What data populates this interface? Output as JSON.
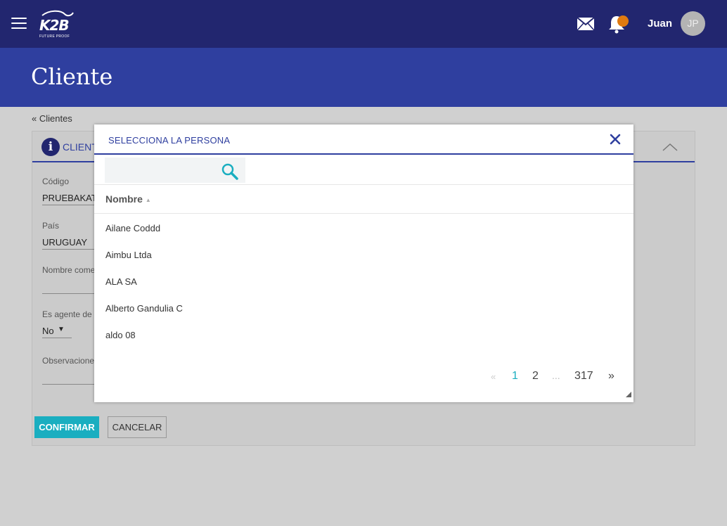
{
  "header": {
    "logo_text": "K2B",
    "logo_tagline": "FUTURE PROOF",
    "user_name": "Juan",
    "avatar_initials": "JP",
    "notification_color": "#e07a10",
    "bar_color": "#22266f"
  },
  "page": {
    "title": "Cliente",
    "breadcrumb": "« Clientes"
  },
  "card": {
    "title": "CLIENT",
    "fields": [
      {
        "label": "Código",
        "value": "PRUEBAKAT"
      },
      {
        "label": "País",
        "value": "URUGUAY"
      },
      {
        "label": "Nombre come",
        "value": ""
      },
      {
        "label": "Es agente de r",
        "value": "No"
      },
      {
        "label": "Observacione",
        "value": ""
      }
    ],
    "confirm_label": "CONFIRMAR",
    "cancel_label": "CANCELAR"
  },
  "modal": {
    "title": "SELECCIONA LA PERSONA",
    "search_value": "",
    "column_header": "Nombre",
    "items": [
      "Ailane Coddd",
      "Aimbu Ltda",
      "ALA SA",
      "Alberto Gandulia C",
      "aldo 08"
    ],
    "pagination": {
      "prev": "«",
      "current": "1",
      "next_page": "2",
      "ellipsis": "...",
      "last": "317",
      "next": "»"
    }
  },
  "icons": [
    "menu-icon",
    "mail-icon",
    "bell-icon",
    "info-icon",
    "chevron-up-icon",
    "close-icon",
    "search-icon",
    "sort-asc-icon",
    "resize-grip-icon"
  ],
  "colors": {
    "accent": "#1aaec0",
    "primary": "#2f3f9f"
  }
}
